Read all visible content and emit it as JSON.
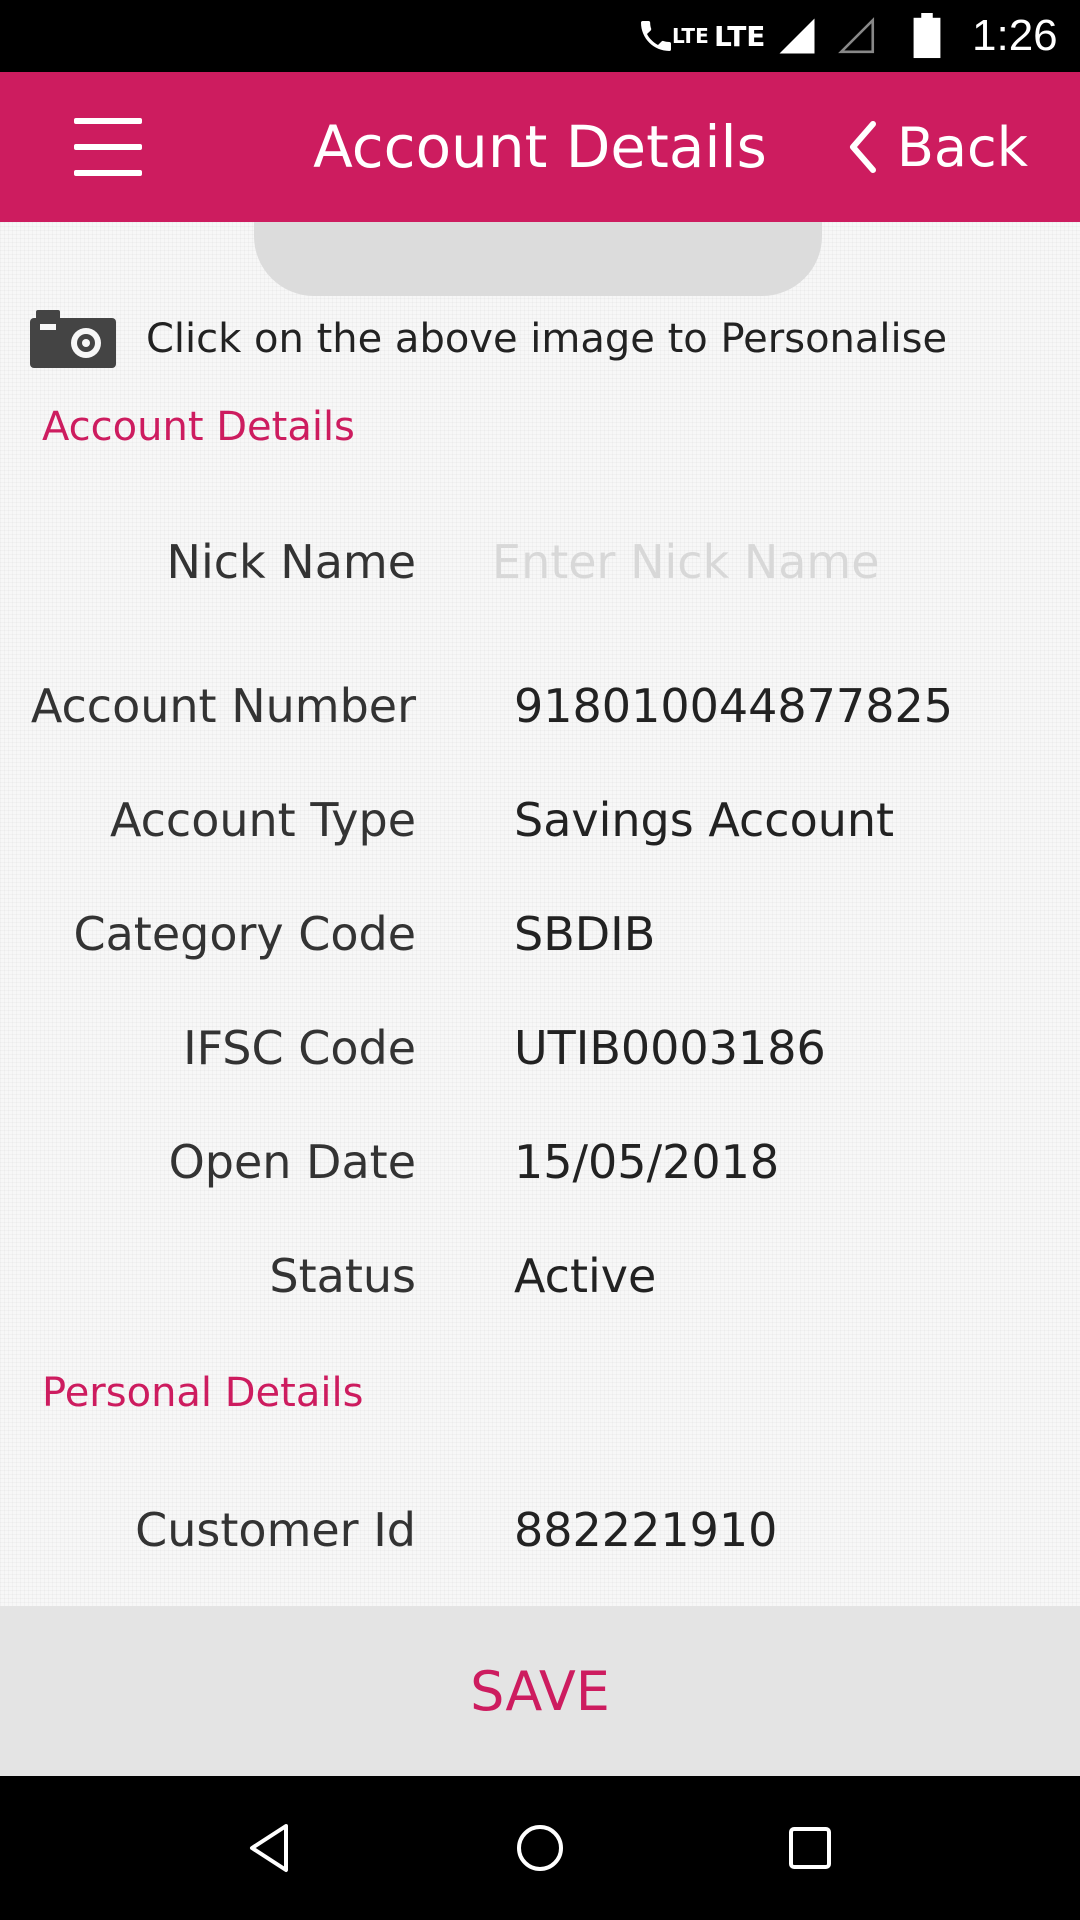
{
  "status_bar": {
    "lte_call": "LTE",
    "lte_data": "LTE",
    "time": "1:26",
    "icons": [
      "call-icon",
      "lte-icon",
      "signal-icon",
      "signal-empty-icon",
      "battery-icon"
    ]
  },
  "app_bar": {
    "title": "Account Details",
    "back_label": "Back",
    "color": "#cd1c5f"
  },
  "personalise": {
    "text": "Click on the above image to Personalise"
  },
  "account_section": {
    "title": "Account Details",
    "nick_name": {
      "label": "Nick Name",
      "placeholder": "Enter Nick Name",
      "value": ""
    },
    "rows": [
      {
        "label": "Account Number",
        "value": "918010044877825"
      },
      {
        "label": "Account Type",
        "value": "Savings Account"
      },
      {
        "label": "Category Code",
        "value": "SBDIB"
      },
      {
        "label": "IFSC Code",
        "value": "UTIB0003186"
      },
      {
        "label": "Open Date",
        "value": "15/05/2018"
      },
      {
        "label": "Status",
        "value": "Active"
      }
    ]
  },
  "personal_section": {
    "title": "Personal Details",
    "rows": [
      {
        "label": "Customer Id",
        "value": "882221910"
      }
    ]
  },
  "save": {
    "label": "SAVE"
  }
}
